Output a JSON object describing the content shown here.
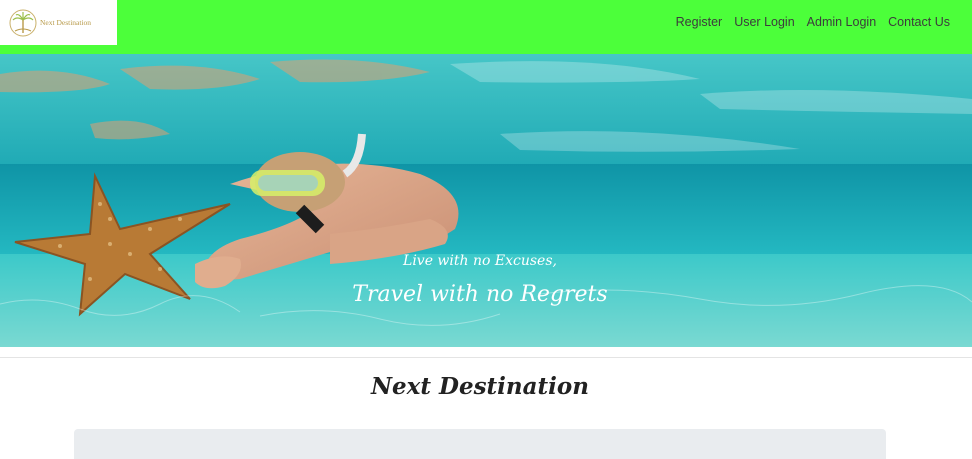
{
  "brand": {
    "name": "Next Destination",
    "logo_icon": "palm-tree-emblem-icon",
    "logo_color": "#b89a4a"
  },
  "navbar": {
    "background": "#4cff3a",
    "links": [
      "Register",
      "User Login",
      "Admin Login",
      "Contact Us"
    ]
  },
  "hero": {
    "line1": "Live with no Excuses,",
    "line2": "Travel with no Regrets",
    "image_subject": "snorkeler-with-starfish-underwater"
  },
  "main": {
    "title": "Next Destination"
  }
}
